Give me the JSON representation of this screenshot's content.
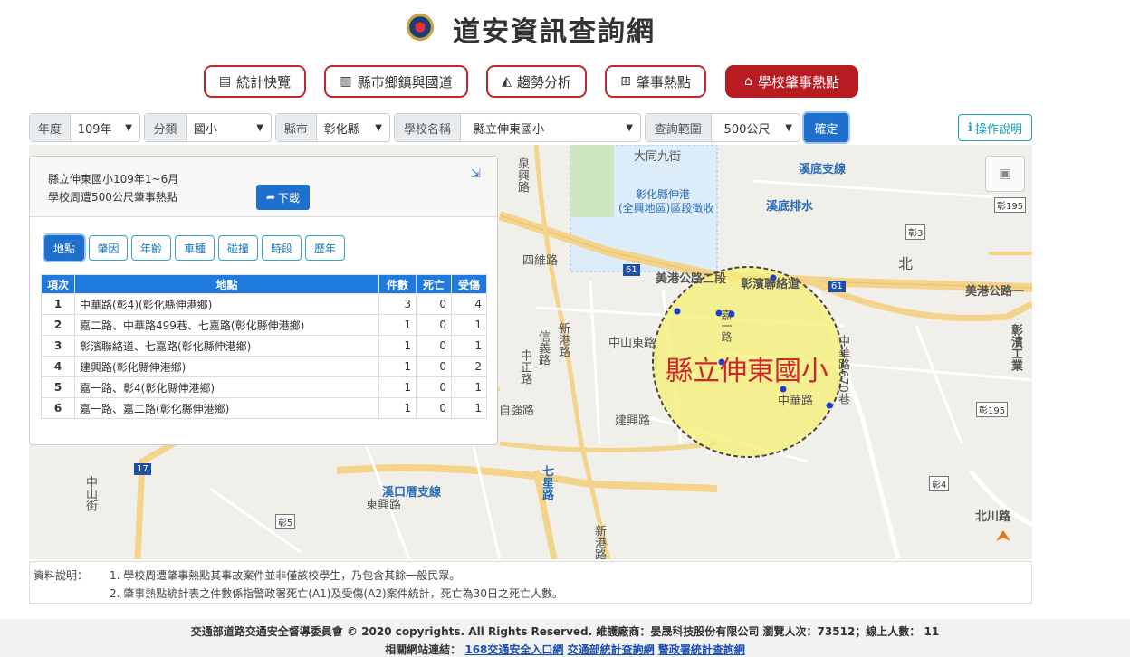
{
  "header": {
    "title": "道安資訊查詢網"
  },
  "nav": [
    {
      "label": "統計快覽",
      "icon": "newspaper-icon"
    },
    {
      "label": "縣市鄉鎮與國道",
      "icon": "bar-chart-icon"
    },
    {
      "label": "趨勢分析",
      "icon": "area-chart-icon"
    },
    {
      "label": "肇事熱點",
      "icon": "map-icon"
    },
    {
      "label": "學校肇事熱點",
      "icon": "school-icon"
    }
  ],
  "filters": {
    "year_label": "年度",
    "year_value": "109年",
    "category_label": "分類",
    "category_value": "國小",
    "county_label": "縣市",
    "county_value": "彰化縣",
    "school_label": "學校名稱",
    "school_value": "縣立伸東國小",
    "range_label": "查詢範圍",
    "range_value": "500公尺",
    "confirm": "確定",
    "help": "操作說明"
  },
  "panel": {
    "line1": "縣立伸東國小109年1~6月",
    "line2": "學校周遭500公尺肇事熱點",
    "download": "下載",
    "tabs": [
      "地點",
      "肇因",
      "年齡",
      "車種",
      "碰撞",
      "時段",
      "歷年"
    ],
    "columns": [
      "項次",
      "地點",
      "件數",
      "死亡",
      "受傷"
    ],
    "rows": [
      [
        "1",
        "中華路(彰4)(彰化縣伸港鄉)",
        "3",
        "0",
        "4"
      ],
      [
        "2",
        "嘉二路、中華路499巷、七嘉路(彰化縣伸港鄉)",
        "1",
        "0",
        "1"
      ],
      [
        "3",
        "彰濱聯絡道、七嘉路(彰化縣伸港鄉)",
        "1",
        "0",
        "1"
      ],
      [
        "4",
        "建興路(彰化縣伸港鄉)",
        "1",
        "0",
        "2"
      ],
      [
        "5",
        "嘉一路、彰4(彰化縣伸港鄉)",
        "1",
        "0",
        "1"
      ],
      [
        "6",
        "嘉一路、嘉二路(彰化縣伸港鄉)",
        "1",
        "0",
        "1"
      ]
    ]
  },
  "map": {
    "circle_label": "縣立伸東國小",
    "labels": {
      "datong": "大同九街",
      "xidi": "溪底支線",
      "xidi_drain": "溪底排水",
      "quanxing": "泉興路",
      "zone1": "彰化縣伸港",
      "zone2": "(全興地區)區段徵收",
      "siwei": "四維路",
      "meigang_a": "美港公路二段",
      "zhangbin": "彰濱聯絡道",
      "meigang_b": "美港公路一",
      "zhongshan": "中山東路",
      "xingang_a": "新港路",
      "xinqiang": "信義路",
      "zhongzheng": "中正路",
      "zhongqiang": "自強路",
      "jianxing": "建興路",
      "zhonghua_a": "中華路",
      "zhonghua670": "中華路670巷",
      "jiayi": "嘉一路",
      "bei": "北",
      "zhangbin_b": "彰濱工業",
      "xikou": "溪口厝支線",
      "dongxing": "東興路",
      "qixin": "七星路",
      "zhongshan_b": "中山街",
      "xingang_b": "新港路",
      "beichuan": "北川路",
      "r61a": "61",
      "r61b": "61",
      "r17": "17",
      "z195a": "彰195",
      "z3": "彰3",
      "z195b": "彰195",
      "z4": "彰4",
      "z5": "彰5"
    },
    "highlight_color": "#f5f07a",
    "accent_color": "#d0262b"
  },
  "notes": {
    "label": "資料說明：",
    "n1": "1. 學校周遭肇事熱點其事故案件並非僅該校學生，乃包含其餘一般民眾。",
    "n2": "2. 肇事熱點統計表之件數係指警政署死亡(A1)及受傷(A2)案件統計，死亡為30日之死亡人數。"
  },
  "footer": {
    "line1": "交通部道路交通安全督導委員會 © 2020 copyrights. All Rights Reserved. 維護廠商：晏晟科技股份有限公司 瀏覽人次：73512；線上人數： 11",
    "line2_prefix": "相關網站連結：",
    "link1": "168交通安全入口網",
    "link2": "交通部統計查詢網",
    "link3": "警政署統計查詢網"
  }
}
